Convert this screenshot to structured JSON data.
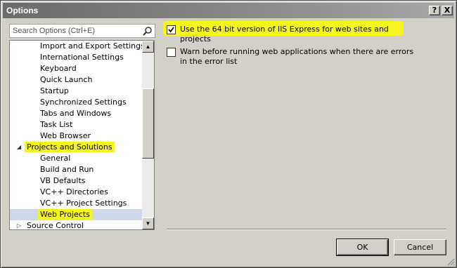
{
  "window": {
    "title": "Options"
  },
  "titlebar": {
    "help_label": "?",
    "close_label": "X"
  },
  "search": {
    "placeholder": "Search Options (Ctrl+E)"
  },
  "tree": {
    "items": [
      {
        "label": "Import and Export Settings",
        "level": "child"
      },
      {
        "label": "International Settings",
        "level": "child"
      },
      {
        "label": "Keyboard",
        "level": "child"
      },
      {
        "label": "Quick Launch",
        "level": "child"
      },
      {
        "label": "Startup",
        "level": "child"
      },
      {
        "label": "Synchronized Settings",
        "level": "child"
      },
      {
        "label": "Tabs and Windows",
        "level": "child"
      },
      {
        "label": "Task List",
        "level": "child"
      },
      {
        "label": "Web Browser",
        "level": "child"
      },
      {
        "label": "Projects and Solutions",
        "level": "parent",
        "expanded": true,
        "highlighted": true
      },
      {
        "label": "General",
        "level": "child"
      },
      {
        "label": "Build and Run",
        "level": "child"
      },
      {
        "label": "VB Defaults",
        "level": "child"
      },
      {
        "label": "VC++ Directories",
        "level": "child"
      },
      {
        "label": "VC++ Project Settings",
        "level": "child"
      },
      {
        "label": "Web Projects",
        "level": "child",
        "selected": true,
        "highlighted": true
      },
      {
        "label": "Source Control",
        "level": "parent",
        "expanded": false
      }
    ]
  },
  "options": {
    "use_64bit": {
      "label": "Use the 64 bit version of IIS Express for web sites and projects",
      "checked": true,
      "highlighted": true
    },
    "warn_errors": {
      "label": "Warn before running web applications when there are errors in the error list",
      "checked": false
    }
  },
  "buttons": {
    "ok_label": "OK",
    "cancel_label": "Cancel"
  },
  "colors": {
    "highlight": "#f7f51f",
    "selected_row": "#cfd8e8",
    "titlebar": "#7a7a7a"
  },
  "icons": {
    "search": "magnifier-icon",
    "expanded": "triangle-expanded-icon",
    "collapsed": "triangle-collapsed-icon"
  }
}
